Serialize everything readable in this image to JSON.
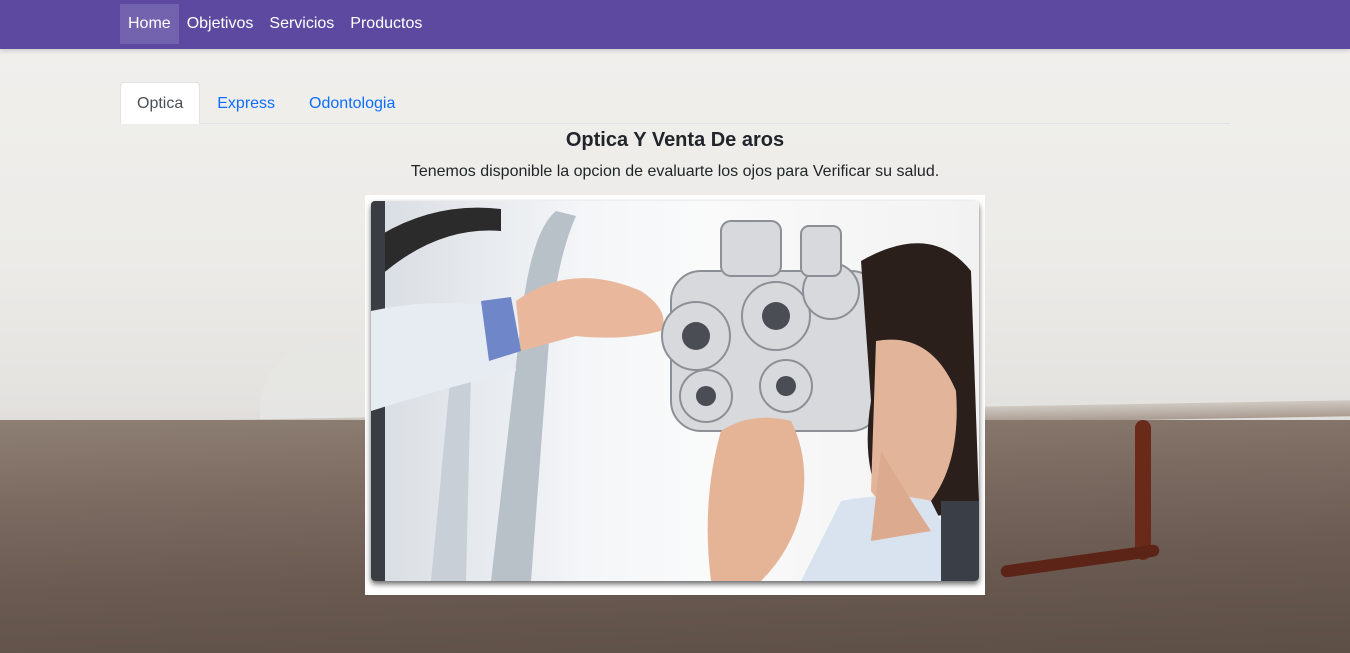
{
  "nav": {
    "items": [
      {
        "label": "Home",
        "active": true
      },
      {
        "label": "Objetivos",
        "active": false
      },
      {
        "label": "Servicios",
        "active": false
      },
      {
        "label": "Productos",
        "active": false
      }
    ]
  },
  "tabs": [
    {
      "label": "Optica",
      "active": true
    },
    {
      "label": "Express",
      "active": false
    },
    {
      "label": "Odontologia",
      "active": false
    }
  ],
  "panel": {
    "title": "Optica Y Venta De aros",
    "description": "Tenemos disponible la opcion de evaluarte los ojos para Verificar su salud."
  },
  "colors": {
    "navbar": "#5d49a0",
    "link": "#0d6efd",
    "active_tab_text": "#495057"
  }
}
